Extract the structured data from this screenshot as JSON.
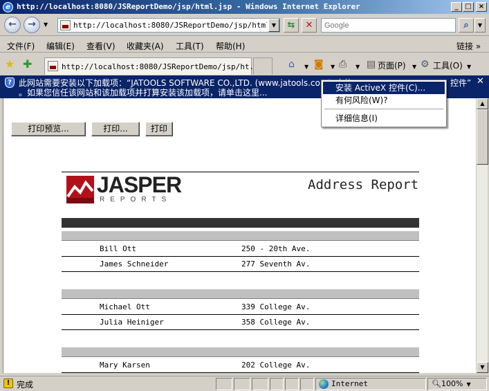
{
  "window": {
    "title": "http://localhost:8080/JSReportDemo/jsp/html.jsp - Windows Internet Explorer"
  },
  "address_bar": {
    "url": "http://localhost:8080/JSReportDemo/jsp/html.jsp",
    "search_placeholder": "Google"
  },
  "menu": {
    "items": [
      "文件(F)",
      "编辑(E)",
      "查看(V)",
      "收藏夹(A)",
      "工具(T)",
      "帮助(H)"
    ],
    "links_label": "链接"
  },
  "tab": {
    "label": "http://localhost:8080/JSReportDemo/jsp/ht..."
  },
  "commands": {
    "page_label": "页面(P)",
    "tools_label": "工具(O)"
  },
  "infobar": {
    "line1": "此网站需要安装以下加载项：“JATOOLS SOFTWARE CO.,LTD. (www.jatools.com)”中的",
    "line2": "。如果您信任该网站和该加载项并打算安装该加载项，请单击这里...",
    "right_tail": "控件”"
  },
  "context_menu": {
    "items": [
      "安装 ActiveX 控件(C)...",
      "有何风险(W)?",
      "详细信息(I)"
    ],
    "selected_index": 0
  },
  "page_buttons": {
    "print_preview": "打印预览...",
    "print_dialog": "打印...",
    "print": "打印"
  },
  "report": {
    "logo_text": "JASPER",
    "logo_subtext": "REPORTS",
    "title": "Address Report",
    "groups": [
      {
        "rows": [
          {
            "name": "Bill Ott",
            "address": "250 - 20th Ave."
          },
          {
            "name": "James Schneider",
            "address": "277 Seventh Av."
          }
        ]
      },
      {
        "rows": [
          {
            "name": "Michael Ott",
            "address": "339 College Av."
          },
          {
            "name": "Julia Heiniger",
            "address": "358 College Av."
          }
        ]
      },
      {
        "rows": [
          {
            "name": "Mary Karsen",
            "address": "202 College Av."
          }
        ]
      }
    ]
  },
  "statusbar": {
    "text": "完成",
    "zone": "Internet",
    "zoom": "100%"
  }
}
